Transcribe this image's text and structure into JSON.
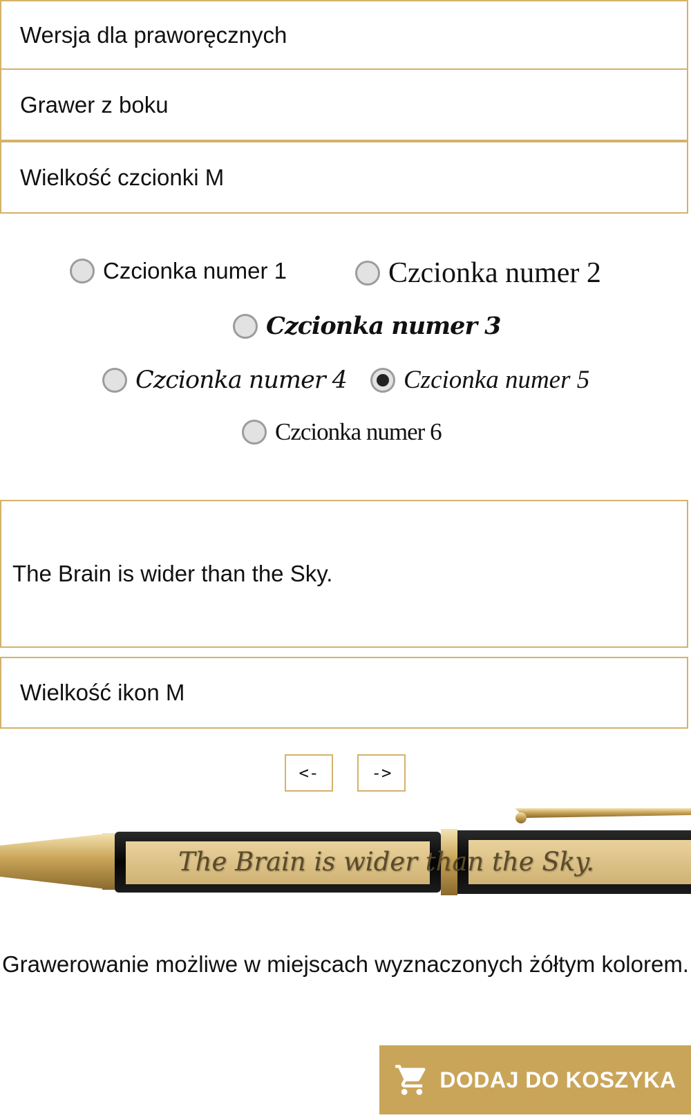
{
  "options": {
    "hand_version": "Wersja dla praworęcznych",
    "engrave_side": "Grawer z boku",
    "font_size": "Wielkość czcionki M",
    "icon_size": "Wielkość ikon M"
  },
  "fonts": [
    {
      "label": "Czcionka numer 1",
      "checked": false
    },
    {
      "label": "Czcionka numer 2",
      "checked": false
    },
    {
      "label": "Czcionka numer 3",
      "checked": false
    },
    {
      "label": "Czcionka numer 4",
      "checked": false
    },
    {
      "label": "Czcionka numer 5",
      "checked": true
    },
    {
      "label": "Czcionka numer 6",
      "checked": false
    }
  ],
  "engraving_text": "The Brain is wider than the Sky.",
  "nav": {
    "prev": "<-",
    "next": "->"
  },
  "preview_text": "The Brain is wider than the Sky.",
  "info_text": "Grawerowanie możliwe w miejscach wyznaczonych żółtym kolorem.",
  "cart_button": {
    "label": "DODAJ DO KOSZYKA",
    "icon": "cart-icon"
  },
  "colors": {
    "accent": "#d4b26a",
    "button": "#c9a55a"
  }
}
